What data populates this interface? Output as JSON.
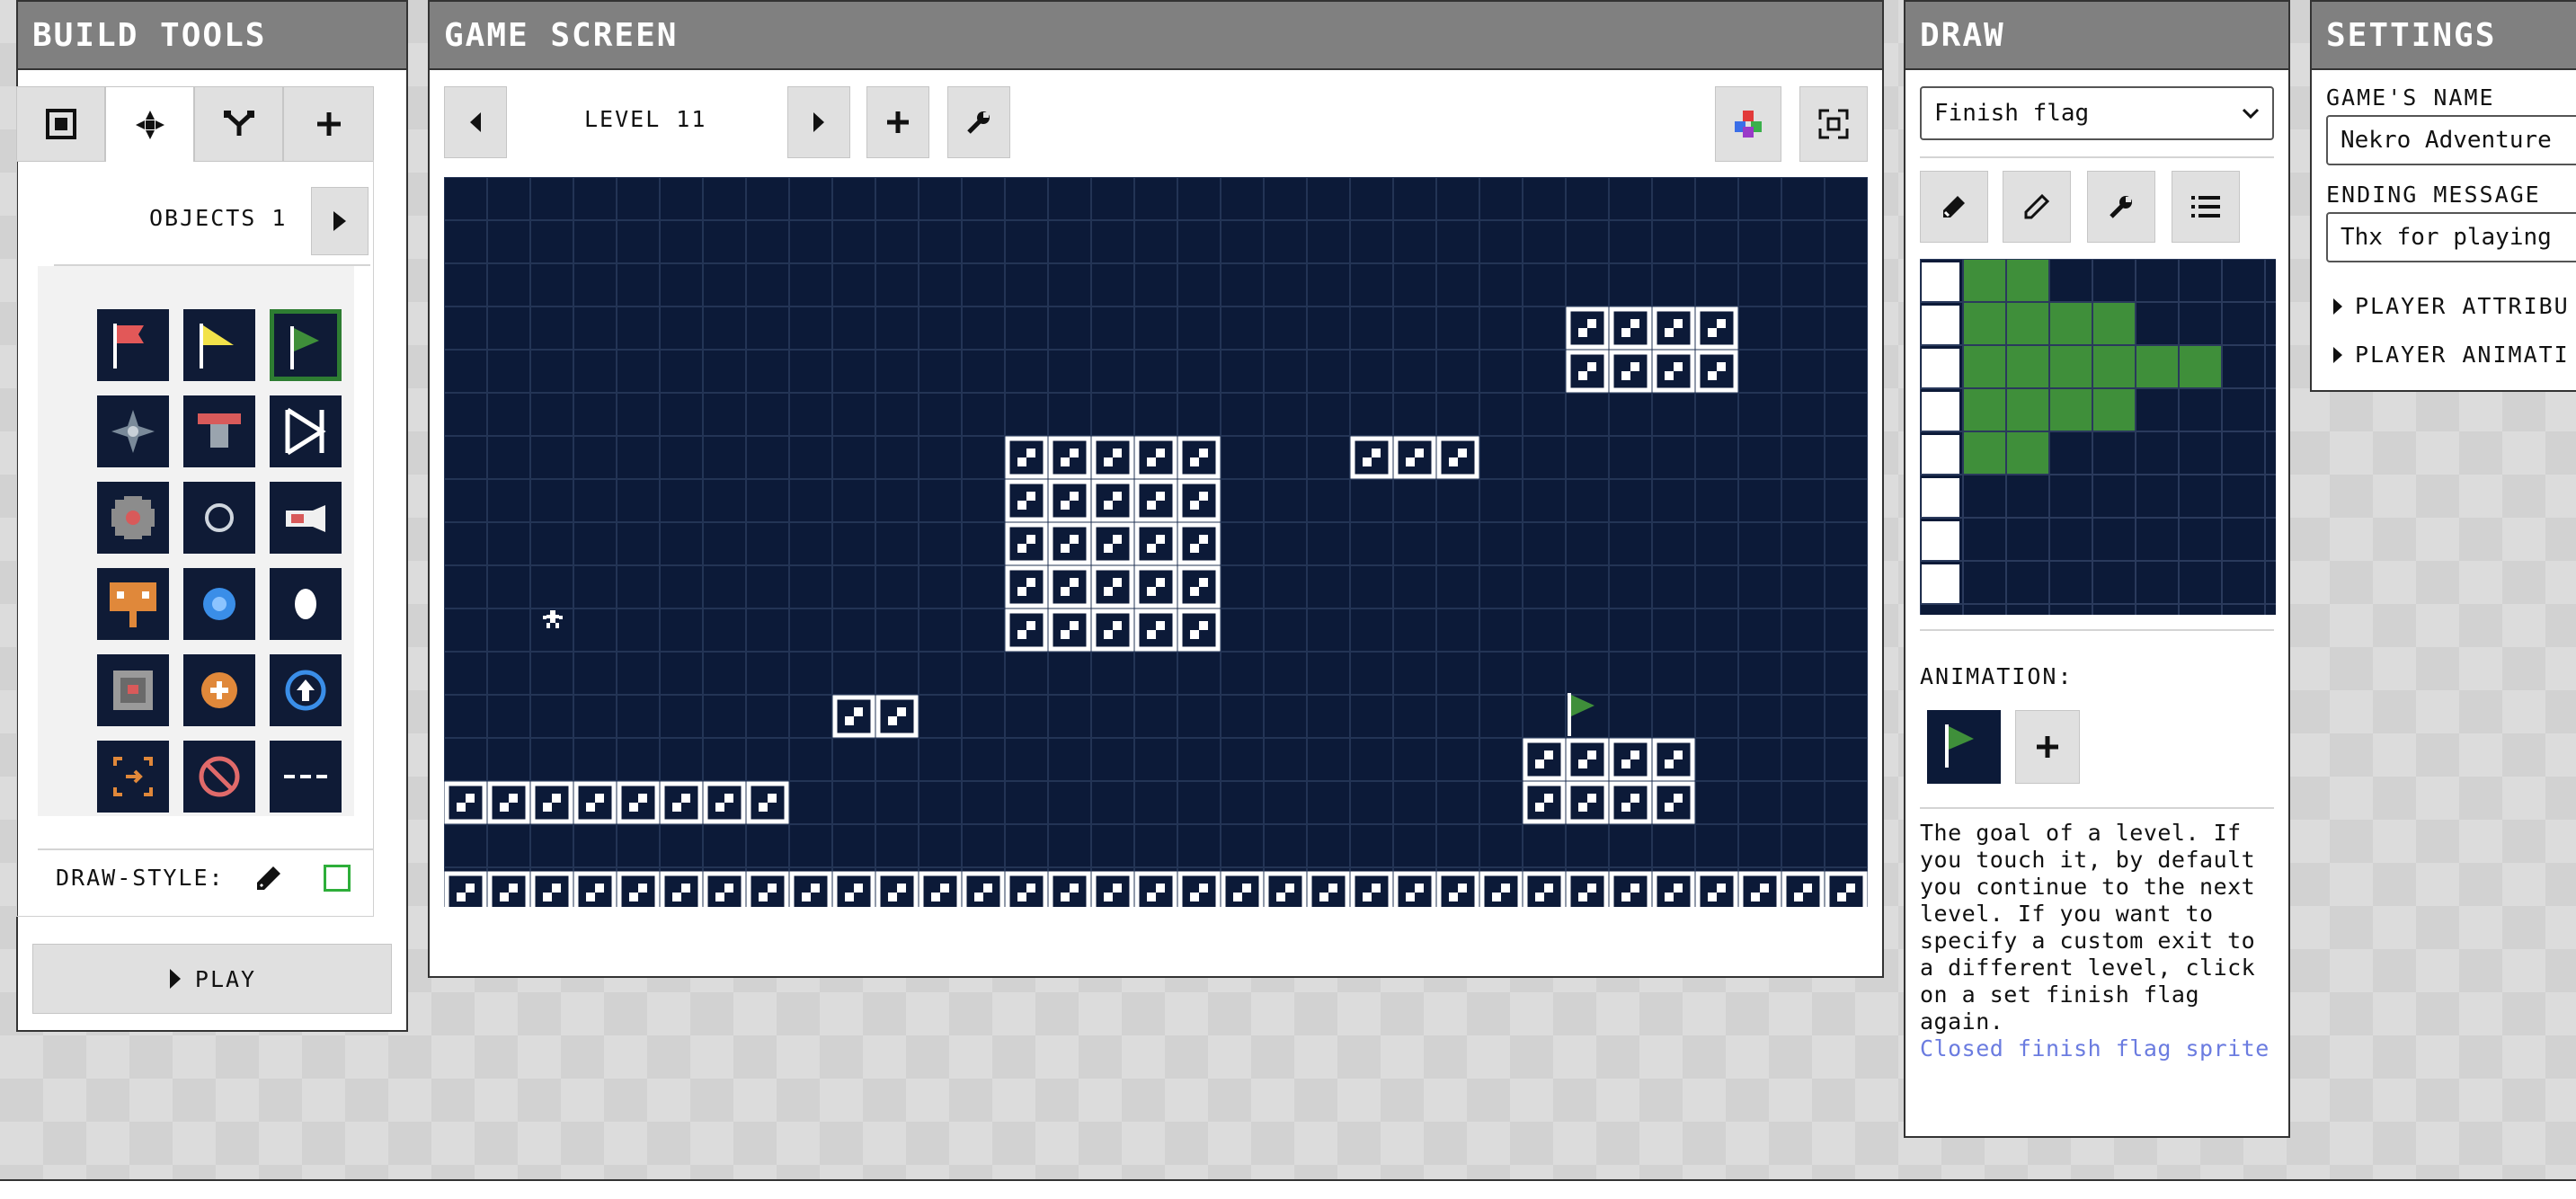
{
  "build_tools": {
    "title": "BUILD TOOLS",
    "tabs": [
      {
        "icon": "square-select-icon",
        "active": false
      },
      {
        "icon": "move-arrows-icon",
        "active": true
      },
      {
        "icon": "branch-icon",
        "active": false
      },
      {
        "icon": "plus-icon",
        "active": false
      }
    ],
    "objects_label": "OBJECTS 1",
    "palette": [
      {
        "icon": "red-flag-icon"
      },
      {
        "icon": "yellow-flag-icon"
      },
      {
        "icon": "finish-flag-icon",
        "selected": true
      },
      {
        "icon": "spike-star-icon"
      },
      {
        "icon": "spring-icon"
      },
      {
        "icon": "bounce-arrow-icon"
      },
      {
        "icon": "sawblade-icon"
      },
      {
        "icon": "ring-icon"
      },
      {
        "icon": "cannon-icon"
      },
      {
        "icon": "sign-icon"
      },
      {
        "icon": "blue-gem-icon"
      },
      {
        "icon": "egg-icon"
      },
      {
        "icon": "switch-block-icon"
      },
      {
        "icon": "orange-coin-icon"
      },
      {
        "icon": "blue-up-arrow-icon"
      },
      {
        "icon": "target-icon"
      },
      {
        "icon": "no-entry-icon"
      },
      {
        "icon": "dashed-line-icon"
      }
    ],
    "draw_style_label": "DRAW-STYLE:",
    "play_label": "PLAY"
  },
  "game_screen": {
    "title": "GAME SCREEN",
    "level_label": "LEVEL 11"
  },
  "draw": {
    "title": "DRAW",
    "sprite_selected": "Finish flag",
    "animation_label": "ANIMATION:",
    "description": "The goal of a level. If you touch it, by default you continue to the next level. If you want to specify a custom exit to a different level, click on a set finish flag again.",
    "link_text": "Closed finish flag sprite"
  },
  "settings": {
    "title": "SETTINGS",
    "game_name_label": "GAME'S NAME",
    "game_name_value": "Nekro Adventure",
    "ending_label": "ENDING MESSAGE",
    "ending_value": "Thx for playing",
    "player_attributes_label": "PLAYER ATTRIBU",
    "player_animations_label": "PLAYER ANIMATI"
  },
  "colors": {
    "level_bg": "#0c1a38",
    "panel_header": "#808080",
    "flag_green": "#3f8f3a",
    "link": "#6b7ce0"
  }
}
